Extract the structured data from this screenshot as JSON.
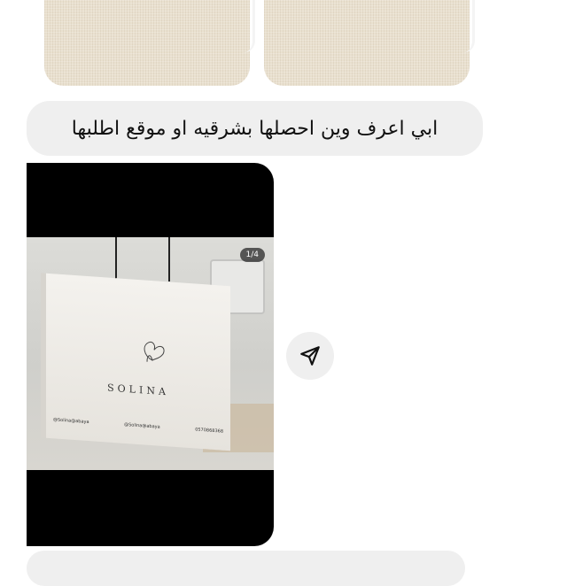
{
  "message": {
    "text": "ابي اعرف وين احصلها بشرقيه او موقع اطلبها"
  },
  "post": {
    "counter": "1/4",
    "brand_name": "SOLINA",
    "contacts": [
      "@Solina@abaya",
      "@Solina@abaya",
      "0570868368"
    ]
  },
  "icons": {
    "share": "send-icon"
  }
}
